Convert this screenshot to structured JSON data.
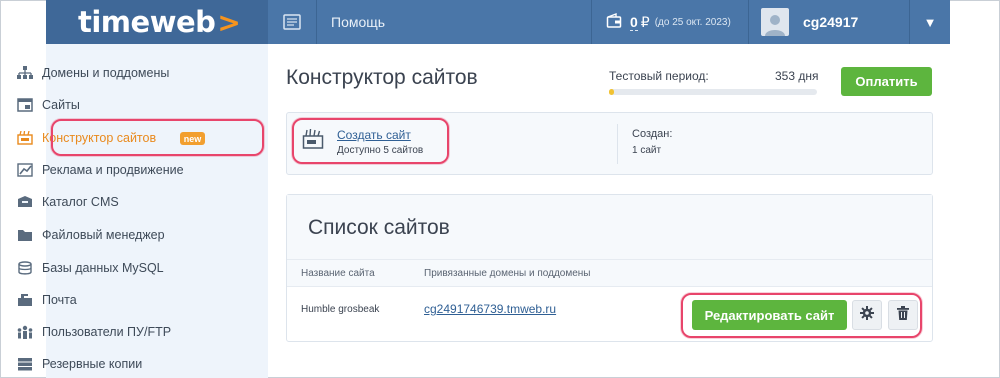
{
  "header": {
    "logo_text": "timeweb",
    "logo_chevron": ">",
    "help_label": "Помощь",
    "balance_amount": "0",
    "balance_currency": "₽",
    "balance_until": "(до 25 окт. 2023)",
    "username": "cg24917",
    "menu_caret": "▼"
  },
  "sidebar": {
    "items": [
      {
        "label": "Домены и поддомены",
        "icon": "sitemap-icon"
      },
      {
        "label": "Сайты",
        "icon": "window-icon"
      },
      {
        "label": "Конструктор сайтов",
        "icon": "constructor-icon",
        "active": true,
        "badge": "new"
      },
      {
        "label": "Реклама и продвижение",
        "icon": "chart-icon"
      },
      {
        "label": "Каталог CMS",
        "icon": "box-icon"
      },
      {
        "label": "Файловый менеджер",
        "icon": "folder-icon"
      },
      {
        "label": "Базы данных MySQL",
        "icon": "database-icon"
      },
      {
        "label": "Почта",
        "icon": "mailbox-icon"
      },
      {
        "label": "Пользователи ПУ/FTP",
        "icon": "users-icon"
      },
      {
        "label": "Резервные копии",
        "icon": "server-icon"
      }
    ]
  },
  "main": {
    "title": "Конструктор сайтов",
    "trial_label": "Тестовый период:",
    "trial_days": "353 дня",
    "trial_progress": 0.02,
    "pay_button": "Оплатить",
    "create_link": "Создать сайт",
    "create_sub": "Доступно 5 сайтов",
    "created_label": "Создан:",
    "created_value": "1 сайт",
    "list_title": "Список сайтов",
    "columns": [
      "Название сайта",
      "Привязанные домены и поддомены"
    ],
    "rows": [
      {
        "name": "Humble grosbeak",
        "domain": "cg2491746739.tmweb.ru"
      }
    ],
    "edit_button": "Редактировать сайт"
  },
  "colors": {
    "header_bg": "#4a76a8",
    "sidebar_bg": "#eef4fb",
    "accent_green": "#5db53e",
    "active_orange": "#e98a1d",
    "highlight_red": "#e8456b"
  }
}
